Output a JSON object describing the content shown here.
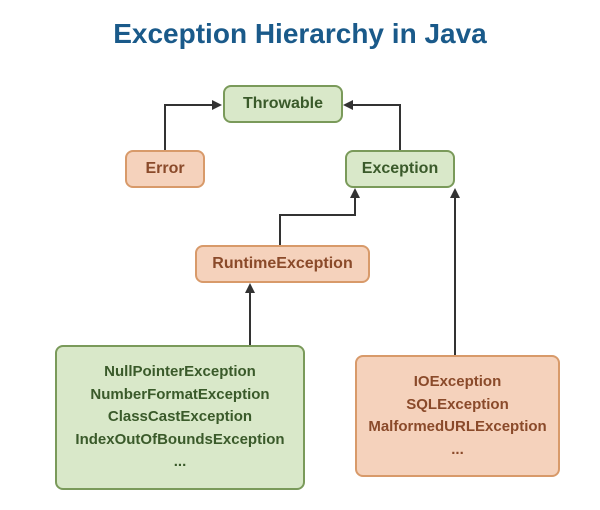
{
  "title": "Exception Hierarchy in Java",
  "nodes": {
    "throwable": "Throwable",
    "error": "Error",
    "exception": "Exception",
    "runtime": "RuntimeException",
    "runtime_list": [
      "NullPointerException",
      "NumberFormatException",
      "ClassCastException",
      "IndexOutOfBoundsException",
      "..."
    ],
    "checked_list": [
      "IOException",
      "SQLException",
      "MalformedURLException",
      "..."
    ]
  }
}
